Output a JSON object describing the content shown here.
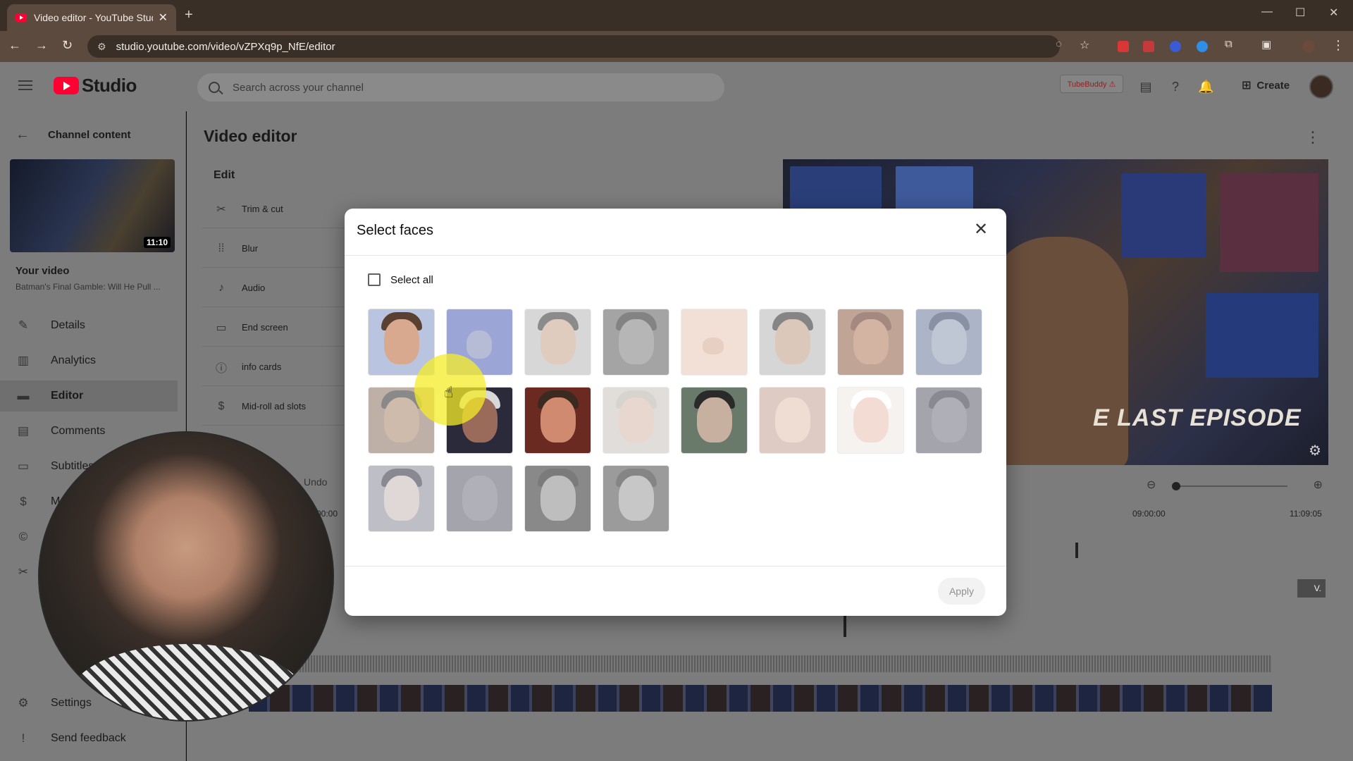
{
  "browser": {
    "tab_title": "Video editor - YouTube Studio",
    "url": "studio.youtube.com/video/vZPXq9p_NfE/editor"
  },
  "header": {
    "brand": "Studio",
    "search_placeholder": "Search across your channel",
    "tubebuddy": "TubeBuddy ⚠",
    "create_label": "Create"
  },
  "sidebar": {
    "back_label": "Channel content",
    "thumb_duration": "11:10",
    "your_video": "Your video",
    "video_title": "Batman's Final Gamble: Will He Pull ...",
    "items": [
      {
        "label": "Details",
        "icon": "pencil-icon"
      },
      {
        "label": "Analytics",
        "icon": "analytics-icon"
      },
      {
        "label": "Editor",
        "icon": "editor-icon"
      },
      {
        "label": "Comments",
        "icon": "comments-icon"
      },
      {
        "label": "Subtitles",
        "icon": "subtitles-icon"
      },
      {
        "label": "M",
        "icon": "monetization-icon"
      },
      {
        "label": "",
        "icon": "copyright-icon"
      },
      {
        "label": "",
        "icon": "scissors-icon"
      }
    ],
    "settings": "Settings",
    "feedback": "Send feedback"
  },
  "main": {
    "title": "Video editor",
    "edit_heading": "Edit",
    "tools": [
      "Trim & cut",
      "Blur",
      "Audio",
      "End screen",
      "info cards",
      "Mid-roll ad slots"
    ],
    "undo": "Undo",
    "timecodes": [
      "00:00",
      "09:00:00",
      "11:09:05"
    ],
    "track_tag": "V.",
    "preview_text": "E LAST EPISODE"
  },
  "modal": {
    "title": "Select faces",
    "select_all": "Select all",
    "apply": "Apply",
    "face_count": 20
  },
  "colors": {
    "accent": "#ff0033",
    "highlight": "#f5ec28"
  }
}
